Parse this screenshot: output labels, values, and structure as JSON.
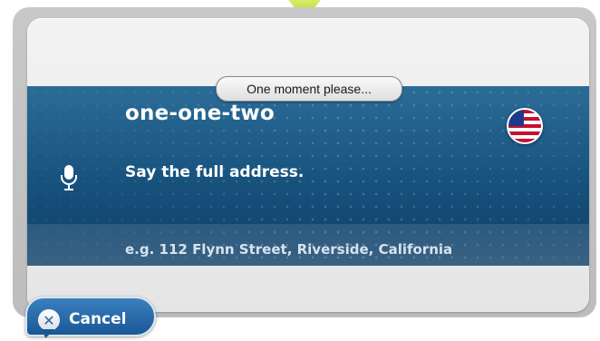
{
  "status": {
    "text": "One moment please..."
  },
  "voice": {
    "recognized_text": "one-one-two",
    "prompt": "Say the full address.",
    "example": "e.g. 112 Flynn Street, Riverside, California"
  },
  "icons": {
    "microphone": "microphone-icon",
    "flag": "us-flag-icon",
    "cancel": "close-icon"
  },
  "buttons": {
    "cancel_label": "Cancel"
  },
  "colors": {
    "band": "#16517c",
    "accent_green": "#a9cf22",
    "cancel_blue": "#2a6aab"
  }
}
